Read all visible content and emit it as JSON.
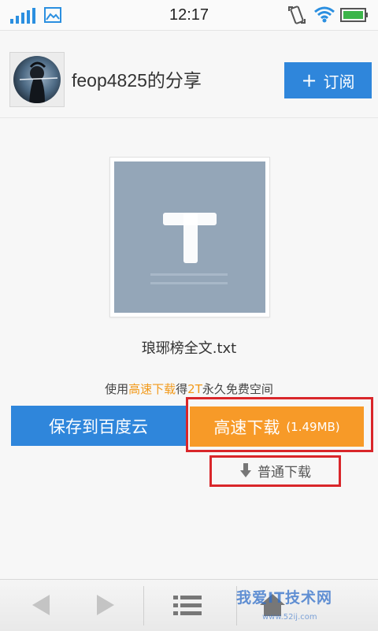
{
  "status_bar": {
    "time": "12:17",
    "icons": [
      "signal-icon",
      "image-notification-icon",
      "rotation-icon",
      "wifi-icon",
      "battery-icon"
    ]
  },
  "header": {
    "title": "feop4825的分享",
    "subscribe_label": "订阅",
    "subscribe_icon": "plus-icon"
  },
  "file": {
    "name": "琅琊榜全文.txt",
    "thumb_letter": "T",
    "thumb_color": "#94a6b8"
  },
  "promo": {
    "prefix": "使用",
    "highlight1": "高速下载",
    "middle": "得",
    "highlight2": "2T",
    "suffix": "永久免费空间",
    "highlight_color": "#f29a1b"
  },
  "actions": {
    "save_label": "保存到百度云",
    "fast_download_label": "高速下载",
    "fast_download_size": "(1.49MB)",
    "normal_download_label": "普通下载"
  },
  "colors": {
    "blue": "#2f86db",
    "orange": "#f79a28",
    "highlight_box": "#d9262a"
  },
  "toolbar": {
    "icons": [
      "back-icon",
      "forward-icon",
      "menu-icon",
      "home-icon"
    ],
    "watermark": "我爱IT技术网",
    "watermark_sub": "www.52ij.com"
  }
}
